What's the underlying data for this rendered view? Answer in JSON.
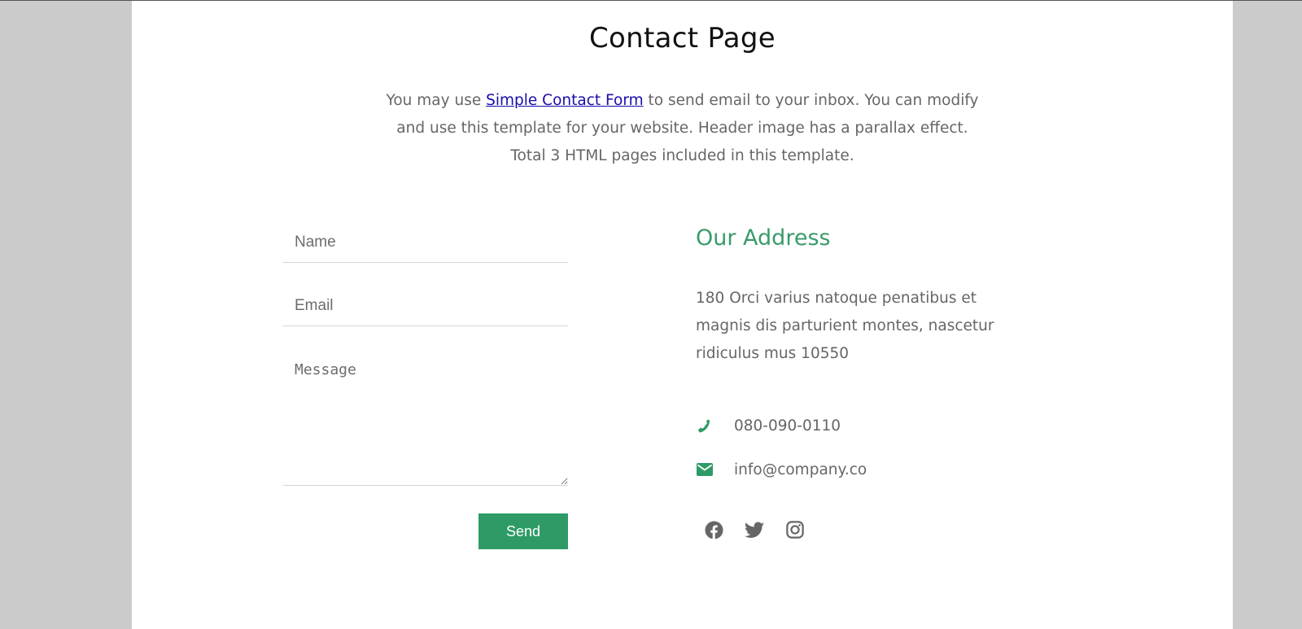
{
  "page": {
    "title": "Contact Page",
    "intro_before_link": "You may use ",
    "intro_link": "Simple Contact Form",
    "intro_after_link": " to send email to your inbox. You can modify",
    "intro_line2": "and use this template for your website. Header image has a parallax effect.",
    "intro_line3": "Total 3 HTML pages included in this template."
  },
  "form": {
    "name_placeholder": "Name",
    "email_placeholder": "Email",
    "message_placeholder": "Message",
    "send_label": "Send"
  },
  "address": {
    "heading": "Our Address",
    "text": "180 Orci varius natoque penatibus et magnis dis parturient montes, nascetur ridiculus mus 10550",
    "phone": "080-090-0110",
    "email": "info@company.co"
  },
  "social": [
    "facebook-icon",
    "twitter-icon",
    "instagram-icon"
  ],
  "colors": {
    "accent": "#2e9b66",
    "heading_green": "#3a9b6a",
    "body_text": "#666666",
    "link": "#1a0dab",
    "side_background": "#cbcbcb"
  }
}
